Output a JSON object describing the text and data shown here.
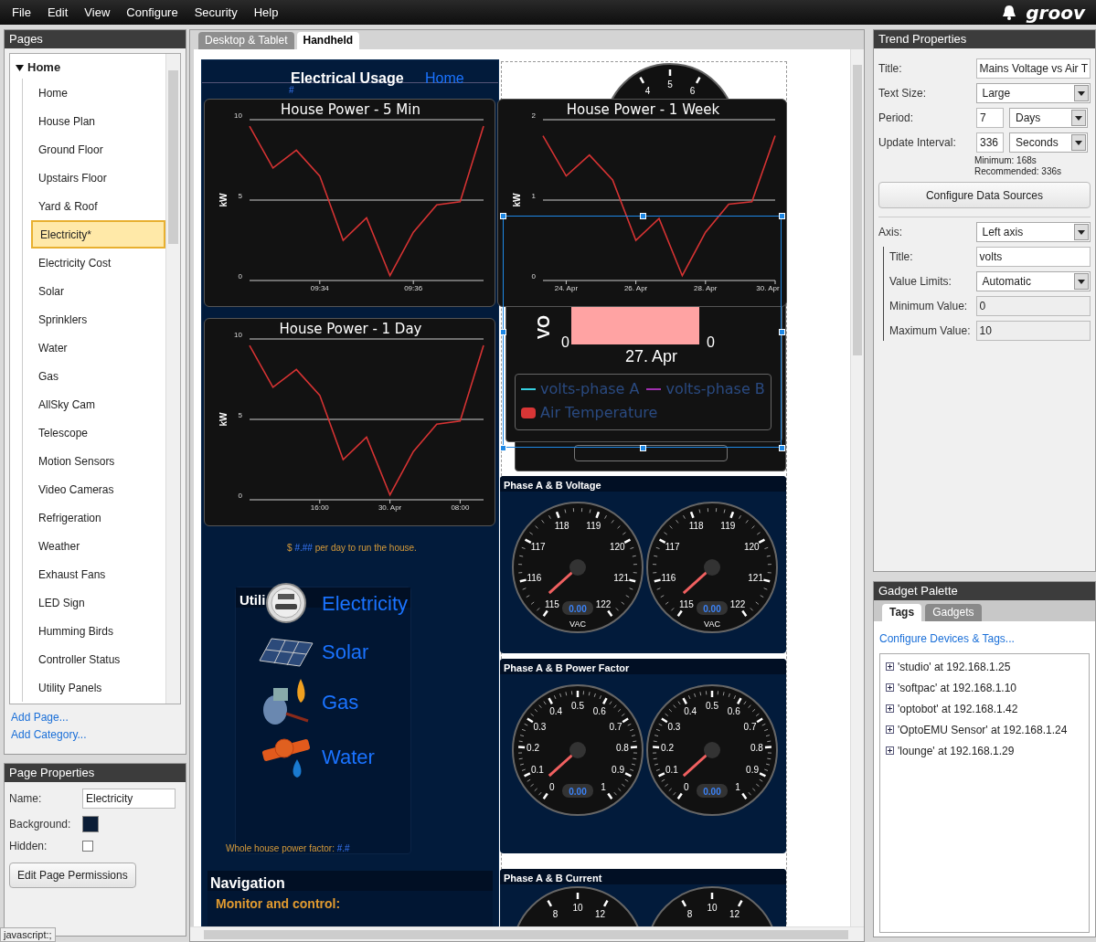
{
  "menu": [
    "File",
    "Edit",
    "View",
    "Configure",
    "Security",
    "Help"
  ],
  "brand": "groov",
  "pages_panel": {
    "title": "Pages",
    "category": {
      "label": "Home",
      "expanded": true,
      "children": [
        {
          "label": "Home",
          "selected": false
        },
        {
          "label": "House Plan",
          "selected": false
        },
        {
          "label": "Ground Floor",
          "selected": false
        },
        {
          "label": "Upstairs Floor",
          "selected": false
        },
        {
          "label": "Yard & Roof",
          "selected": false
        },
        {
          "label": "Electricity*",
          "selected": true
        },
        {
          "label": "Electricity Cost",
          "selected": false
        },
        {
          "label": "Solar",
          "selected": false
        },
        {
          "label": "Sprinklers",
          "selected": false
        },
        {
          "label": "Water",
          "selected": false
        },
        {
          "label": "Gas",
          "selected": false
        },
        {
          "label": "AllSky Cam",
          "selected": false
        },
        {
          "label": "Telescope",
          "selected": false
        },
        {
          "label": "Motion Sensors",
          "selected": false
        },
        {
          "label": "Video Cameras",
          "selected": false
        },
        {
          "label": "Refrigeration",
          "selected": false
        },
        {
          "label": "Weather",
          "selected": false
        },
        {
          "label": "Exhaust Fans",
          "selected": false
        },
        {
          "label": "LED Sign",
          "selected": false
        },
        {
          "label": "Humming Birds",
          "selected": false
        },
        {
          "label": "Controller Status",
          "selected": false
        },
        {
          "label": "Utility Panels",
          "selected": false
        }
      ]
    },
    "links": [
      "Add Page...",
      "Add Category..."
    ]
  },
  "page_properties": {
    "title": "Page Properties",
    "name_label": "Name:",
    "name_value": "Electricity",
    "background_label": "Background:",
    "hidden_label": "Hidden:",
    "hidden": false,
    "button": "Edit Page Permissions"
  },
  "status_bar": "javascript:;",
  "editor_tabs": [
    {
      "label": "Desktop & Tablet",
      "selected": false
    },
    {
      "label": "Handheld",
      "selected": true
    }
  ],
  "canvas": {
    "header": {
      "title": "Electrical Usage",
      "link": "Home",
      "value": "#"
    },
    "charts": [
      {
        "chart_data": {
          "type": "line",
          "title": "House Power - 5 Min",
          "ylabel": "kW",
          "categories": [
            null,
            null,
            null,
            "09:34",
            null,
            null,
            null,
            "09:36",
            null,
            null,
            null
          ],
          "series": [
            {
              "color": "#d63333",
              "values": [
                9.6,
                7,
                8.1,
                6.5,
                2.5,
                3.9,
                0.3,
                3,
                4.7,
                4.9,
                9.6
              ]
            }
          ],
          "ylim": [
            0,
            10
          ],
          "yticks": [
            0,
            5,
            10
          ]
        }
      },
      {
        "chart_data": {
          "type": "line",
          "title": "House Power - 1 Day",
          "ylabel": "kW",
          "categories": [
            null,
            null,
            null,
            "16:00",
            null,
            null,
            "30. Apr",
            null,
            null,
            "08:00",
            null
          ],
          "series": [
            {
              "color": "#d63333",
              "values": [
                9.6,
                7,
                8.1,
                6.5,
                2.5,
                3.9,
                0.3,
                3,
                4.7,
                4.9,
                9.6
              ]
            }
          ],
          "ylim": [
            0,
            10
          ],
          "yticks": [
            0,
            5,
            10
          ]
        }
      },
      {
        "chart_data": {
          "type": "line",
          "title": "House Power - 1 Week",
          "ylabel": "kW",
          "categories": [
            null,
            "24. Apr",
            null,
            null,
            "26. Apr",
            null,
            null,
            "28. Apr",
            null,
            null,
            "30. Apr"
          ],
          "series": [
            {
              "color": "#d63333",
              "values": [
                1.8,
                1.3,
                1.56,
                1.25,
                0.5,
                0.77,
                0.06,
                0.6,
                0.95,
                0.98,
                1.8
              ]
            }
          ],
          "ylim": [
            0,
            2
          ],
          "yticks": [
            0,
            1,
            2
          ]
        }
      }
    ],
    "cost_text": {
      "prefix": "$",
      "value": "#.##",
      "suffix": "per day to run the house."
    },
    "utilities": {
      "title": "Utili",
      "items": [
        {
          "kind": "meter",
          "label": "Electricity"
        },
        {
          "kind": "solar",
          "label": "Solar"
        },
        {
          "kind": "gas",
          "label": "Gas"
        },
        {
          "kind": "water",
          "label": "Water"
        }
      ]
    },
    "power_factor_text": {
      "label": "Whole house power factor:",
      "value": "#.#"
    },
    "navigation": {
      "title": "Navigation",
      "subtitle": "Monitor and control:"
    },
    "top_gauge": {
      "labels": [
        "4",
        "5",
        "6"
      ]
    },
    "trend": {
      "axis_title": "VO",
      "left_zero": "0",
      "right_zero": "0",
      "date": "27. Apr",
      "legend": [
        {
          "label": "volts-phase A",
          "kind": "line",
          "color": "#35d0e0"
        },
        {
          "label": "volts-phase B",
          "kind": "line",
          "color": "#a030b0"
        },
        {
          "label": "Air Temperature",
          "kind": "area",
          "color": "#d93636"
        }
      ]
    },
    "gauge_panels": [
      {
        "title": "Phase A & B Voltage",
        "gauges": [
          {
            "kind": "full",
            "labels": [
              "115",
              "116",
              "117",
              "118",
              "119",
              "120",
              "121",
              "122"
            ],
            "reading": "0.00",
            "unit": "VAC"
          },
          {
            "kind": "full",
            "labels": [
              "115",
              "116",
              "117",
              "118",
              "119",
              "120",
              "121",
              "122"
            ],
            "reading": "0.00",
            "unit": "VAC"
          }
        ]
      },
      {
        "title": "Phase A & B Power Factor",
        "gauges": [
          {
            "kind": "full",
            "labels": [
              "0",
              "0.1",
              "0.2",
              "0.3",
              "0.4",
              "0.5",
              "0.6",
              "0.7",
              "0.8",
              "0.9",
              "1"
            ],
            "reading": "0.00"
          },
          {
            "kind": "full",
            "labels": [
              "0",
              "0.1",
              "0.2",
              "0.3",
              "0.4",
              "0.5",
              "0.6",
              "0.7",
              "0.8",
              "0.9",
              "1"
            ],
            "reading": "0.00"
          }
        ]
      },
      {
        "title": "Phase A & B Current",
        "gauges": [
          {
            "kind": "partial",
            "labels": [
              "8",
              "10",
              "12"
            ]
          },
          {
            "kind": "partial",
            "labels": [
              "8",
              "10",
              "12"
            ]
          }
        ]
      }
    ]
  },
  "trend_properties": {
    "title": "Trend Properties",
    "title_label": "Title:",
    "title_value": "Mains Voltage vs Air T",
    "text_size_label": "Text Size:",
    "text_size": "Large",
    "period_label": "Period:",
    "period_value": "7",
    "period_unit": "Days",
    "interval_label": "Update Interval:",
    "interval_value": "336",
    "interval_unit": "Seconds",
    "minimum_note": "Minimum: 168s",
    "recommended_note": "Recommended: 336s",
    "configure_button": "Configure Data Sources",
    "axis_label": "Axis:",
    "axis_value": "Left axis",
    "axis_title_label": "Title:",
    "axis_title_value": "volts",
    "limits_label": "Value Limits:",
    "limits_value": "Automatic",
    "min_label": "Minimum Value:",
    "min_value": "0",
    "max_label": "Maximum Value:",
    "max_value": "10"
  },
  "gadget_palette": {
    "title": "Gadget Palette",
    "tabs": [
      {
        "label": "Tags",
        "selected": true
      },
      {
        "label": "Gadgets",
        "selected": false
      }
    ],
    "link": "Configure Devices & Tags...",
    "devices": [
      {
        "label": "'studio' at 192.168.1.25",
        "expanded": false
      },
      {
        "label": "'softpac' at 192.168.1.10",
        "expanded": false
      },
      {
        "label": "'optobot' at 192.168.1.42",
        "expanded": false
      },
      {
        "label": "'OptoEMU Sensor' at 192.168.1.24",
        "expanded": false
      },
      {
        "label": "'lounge' at 192.168.1.29",
        "expanded": false
      }
    ]
  }
}
